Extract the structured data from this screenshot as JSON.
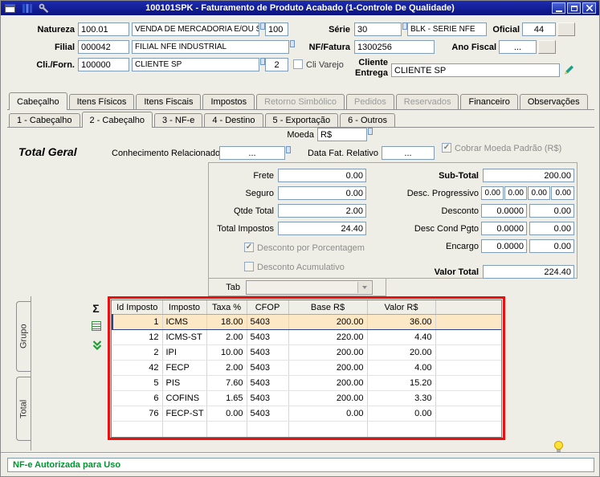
{
  "titlebar": {
    "title": "100101SPK - Faturamento de Produto Acabado (1-Controle De Qualidade)"
  },
  "header": {
    "natureza_label": "Natureza",
    "natureza_code": "100.01",
    "natureza_desc": "VENDA DE MERCADORIA E/OU SERVI",
    "natureza_extra": "100",
    "serie_label": "Série",
    "serie_code": "30",
    "serie_desc": "BLK - SERIE NFE",
    "oficial_label": "Oficial",
    "oficial_value": "44",
    "filial_label": "Filial",
    "filial_code": "000042",
    "filial_desc": "FILIAL NFE INDUSTRIAL",
    "nf_label": "NF/Fatura",
    "nf_value": "1300256",
    "ano_fiscal_label": "Ano Fiscal",
    "ano_fiscal_value": "...",
    "cli_label": "Cli./Forn.",
    "cli_code": "100000",
    "cli_desc": "CLIENTE SP",
    "cli_extra": "2",
    "cli_varejo_label": "Cli Varejo",
    "cliente_entrega_label": "Cliente Entrega",
    "cliente_entrega_value": "CLIENTE SP"
  },
  "tabs_main": [
    {
      "label": "Cabeçalho"
    },
    {
      "label": "Itens Físicos"
    },
    {
      "label": "Itens Fiscais"
    },
    {
      "label": "Impostos"
    },
    {
      "label": "Retorno Simbólico"
    },
    {
      "label": "Pedidos"
    },
    {
      "label": "Reservados"
    },
    {
      "label": "Financeiro"
    },
    {
      "label": "Observações"
    }
  ],
  "tabs_sub": [
    {
      "label": "1 - Cabeçalho"
    },
    {
      "label": "2 - Cabeçalho"
    },
    {
      "label": "3 - NF-e"
    },
    {
      "label": "4 - Destino"
    },
    {
      "label": "5 - Exportação"
    },
    {
      "label": "6 - Outros"
    }
  ],
  "totals": {
    "moeda_label": "Moeda",
    "moeda_value": "R$",
    "section_title": "Total Geral",
    "conhecimento_label": "Conhecimento Relacionado",
    "conhecimento_value": "...",
    "data_fat_label": "Data Fat. Relativo",
    "data_fat_value": "...",
    "cobrar_moeda_label": "Cobrar Moeda Padrão (R$)",
    "frete_label": "Frete",
    "frete_value": "0.00",
    "seguro_label": "Seguro",
    "seguro_value": "0.00",
    "qtde_label": "Qtde Total",
    "qtde_value": "2.00",
    "impostos_label": "Total Impostos",
    "impostos_value": "24.40",
    "desc_pct_label": "Desconto por Porcentagem",
    "desc_acum_label": "Desconto Acumulativo",
    "subtotal_label": "Sub-Total",
    "subtotal_value": "200.00",
    "desc_prog_label": "Desc. Progressivo",
    "desc_prog_values": [
      "0.00",
      "0.00",
      "0.00",
      "0.00"
    ],
    "desconto_label": "Desconto",
    "desconto_pct": "0.0000",
    "desconto_value": "0.00",
    "desc_cond_label": "Desc Cond Pgto",
    "desc_cond_pct": "0.0000",
    "desc_cond_value": "0.00",
    "encargo_label": "Encargo",
    "encargo_pct": "0.0000",
    "encargo_value": "0.00",
    "valor_total_label": "Valor Total",
    "valor_total_value": "224.40",
    "tab_combo_label": "Tab"
  },
  "grid": {
    "columns": [
      "Id Imposto",
      "Imposto",
      "Taxa %",
      "CFOP",
      "Base R$",
      "Valor R$"
    ],
    "rows": [
      [
        "1",
        "ICMS",
        "18.00",
        "5403",
        "200.00",
        "36.00"
      ],
      [
        "12",
        "ICMS-ST",
        "2.00",
        "5403",
        "220.00",
        "4.40"
      ],
      [
        "2",
        "IPI",
        "10.00",
        "5403",
        "200.00",
        "20.00"
      ],
      [
        "42",
        "FECP",
        "2.00",
        "5403",
        "200.00",
        "4.00"
      ],
      [
        "5",
        "PIS",
        "7.60",
        "5403",
        "200.00",
        "15.20"
      ],
      [
        "6",
        "COFINS",
        "1.65",
        "5403",
        "200.00",
        "3.30"
      ],
      [
        "76",
        "FECP-ST",
        "0.00",
        "5403",
        "0.00",
        "0.00"
      ]
    ]
  },
  "side_tabs": [
    {
      "label": "Grupo"
    },
    {
      "label": "Total"
    }
  ],
  "statusbar": {
    "message": "NF-e Autorizada para Uso"
  },
  "icons": {
    "sigma": "Σ",
    "check": "✓"
  }
}
